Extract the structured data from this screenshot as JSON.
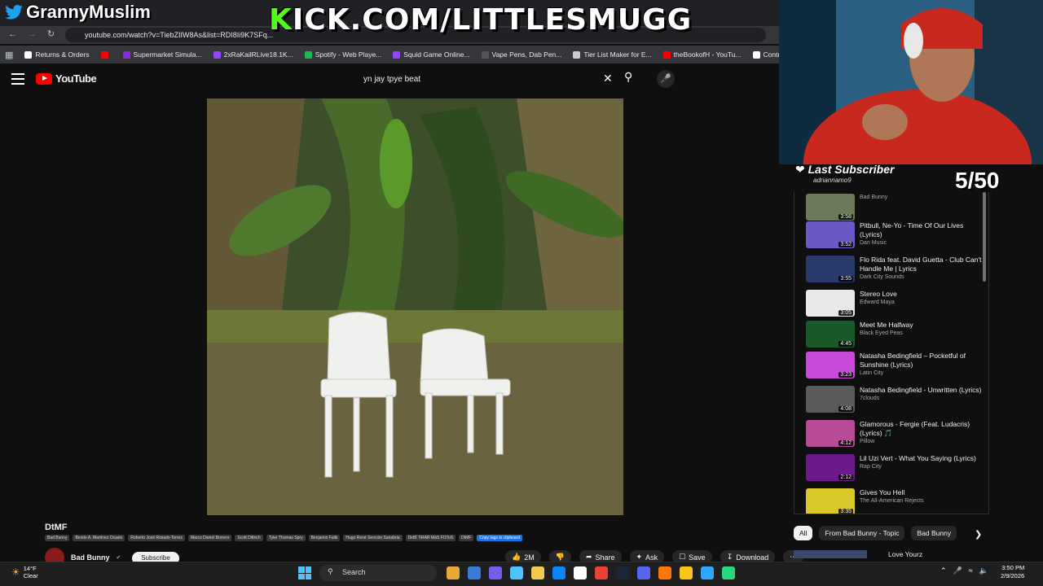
{
  "browser": {
    "url": "youtube.com/watch?v=TiebZIIW8As&list=RDI8Ii9K7SFq...",
    "bookmarks": [
      {
        "label": "Returns & Orders",
        "color": "#ffffff"
      },
      {
        "label": "",
        "color": "#ff0000"
      },
      {
        "label": "Supermarket Simula...",
        "color": "#8a2be2"
      },
      {
        "label": "2xRaKailRLive18.1K...",
        "color": "#9146ff"
      },
      {
        "label": "Spotify - Web Playe...",
        "color": "#1db954"
      },
      {
        "label": "Squid Game Online...",
        "color": "#9146ff"
      },
      {
        "label": "Vape Pens, Dab Pen...",
        "color": "#555555"
      },
      {
        "label": "Tier List Maker for E...",
        "color": "#cccccc"
      },
      {
        "label": "theBookofH - YouTu...",
        "color": "#ff0000"
      },
      {
        "label": "Control Room",
        "color": "#ffffff"
      }
    ]
  },
  "overlay": {
    "twitter_handle": "GrannyMuslim",
    "kick_first": "K",
    "kick_rest": "ICK.COM/LITTLESMUGG",
    "last_subscriber_label": "Last Subscriber",
    "last_subscriber_name": "adriannamo9",
    "sub_goal": "5/50"
  },
  "youtube": {
    "logo": "YouTube",
    "search_value": "yn jay tpye beat",
    "video_title": "DtMF",
    "tags": [
      "Bad Bunny",
      "Benito A. Martínez Ocasio",
      "Roberto José Rosado Torres",
      "Marco Daniel Borrero",
      "Scott Dittrich",
      "Tyler Thomas Spry",
      "Benjamin Falik",
      "Hugo René Sención Sanabria",
      "DeBÍ TiRAR MáS FOToS",
      "DtMF"
    ],
    "copy_tags_label": "Copy tags to clipboard",
    "channel_name": "Bad Bunny",
    "subscribe_label": "Subscribe",
    "like_count": "2M",
    "share_label": "Share",
    "ask_label": "Ask",
    "save_label": "Save",
    "download_label": "Download"
  },
  "playlist": [
    {
      "title": "",
      "channel": "Bad Bunny",
      "duration": "3:58",
      "color": "#6a7a5a"
    },
    {
      "title": "Pitbull, Ne-Yo - Time Of Our Lives (Lyrics)",
      "channel": "Dan Music",
      "duration": "3:52",
      "color": "#6a5ac8"
    },
    {
      "title": "Flo Rida feat. David Guetta - Club Can't Handle Me | Lyrics",
      "channel": "Dark City Sounds",
      "duration": "3:55",
      "color": "#2a3a6a"
    },
    {
      "title": "Stereo Love",
      "channel": "Edward Maya",
      "duration": "3:05",
      "color": "#e8e8e8"
    },
    {
      "title": "Meet Me Halfway",
      "channel": "Black Eyed Peas",
      "duration": "4:45",
      "color": "#1a5a2a"
    },
    {
      "title": "Natasha Bedingfield – Pocketful of Sunshine (Lyrics)",
      "channel": "Latin City",
      "duration": "3:23",
      "color": "#c84ad8"
    },
    {
      "title": "Natasha Bedingfield - Unwritten (Lyrics)",
      "channel": "7clouds",
      "duration": "4:08",
      "color": "#5a5a5a"
    },
    {
      "title": "Glamorous - Fergie (Feat. Ludacris) (Lyrics) 🎵",
      "channel": "Pillow",
      "duration": "4:12",
      "color": "#b84a98"
    },
    {
      "title": "Lil Uzi Vert - What You Saying (Lyrics)",
      "channel": "Rap City",
      "duration": "2:12",
      "color": "#6a1a8a"
    },
    {
      "title": "Gives You Hell",
      "channel": "The All-American Rejects",
      "duration": "3:35",
      "color": "#d8c828"
    }
  ],
  "chips": [
    "All",
    "From Bad Bunny - Topic",
    "Bad Bunny"
  ],
  "next_video_title": "Love Yourz",
  "taskbar": {
    "temp": "14°F",
    "weather": "Clear",
    "search_label": "Search",
    "time": "3:50 PM",
    "date": "2/9/2026",
    "apps": [
      "#e8a838",
      "#3a7bd5",
      "#7a5ae8",
      "#4cc2ff",
      "#f2c94c",
      "#0a84ff",
      "#ffffff",
      "#ea4335",
      "#1b2838",
      "#5865f2",
      "#ff7a00",
      "#f5c518",
      "#31a8ff",
      "#2bd67b"
    ]
  }
}
